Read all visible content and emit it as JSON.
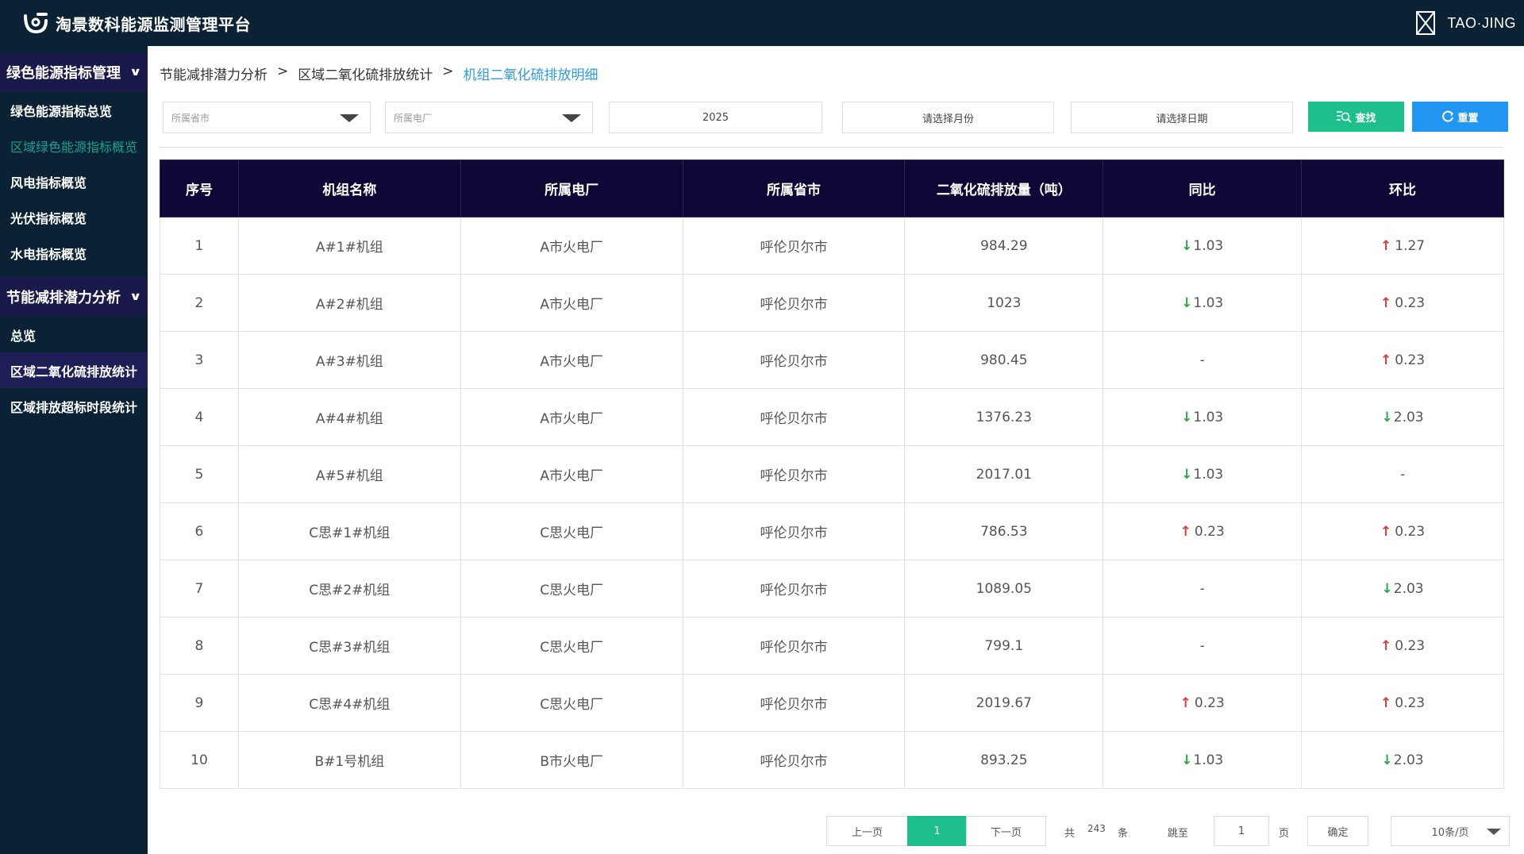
{
  "app": {
    "title": "淘景数科能源监测管理平台",
    "brand_right": "TAO·JING"
  },
  "sidebar": {
    "groups": [
      {
        "label": "绿色能源指标管理",
        "items": [
          "绿色能源指标总览",
          "区域绿色能源指标概览",
          "风电指标概览",
          "光伏指标概览",
          "水电指标概览"
        ]
      },
      {
        "label": "节能减排潜力分析",
        "items": [
          "总览",
          "区域二氧化硫排放统计",
          "区域排放超标时段统计"
        ]
      }
    ]
  },
  "breadcrumb": {
    "level1": "节能减排潜力分析",
    "level2": "区域二氧化硫排放统计",
    "current": "机组二氧化硫排放明细",
    "sep": ">"
  },
  "filters": {
    "province_placeholder": "所属省市",
    "plant_placeholder": "所属电厂",
    "year_value": "2025",
    "month_placeholder": "请选择月份",
    "date_placeholder": "请选择日期",
    "search_label": "查找",
    "reset_label": "重置"
  },
  "table": {
    "headers": [
      "序号",
      "机组名称",
      "所属电厂",
      "所属省市",
      "二氧化硫排放量（吨）",
      "同比",
      "环比"
    ],
    "rows": [
      {
        "no": "1",
        "unit": "A#1#机组",
        "plant": "A市火电厂",
        "city": "呼伦贝尔市",
        "so2": "984.29",
        "yoy_dir": "↓",
        "yoy": "1.03",
        "mom_dir": "↑",
        "mom": "1.27"
      },
      {
        "no": "2",
        "unit": "A#2#机组",
        "plant": "A市火电厂",
        "city": "呼伦贝尔市",
        "so2": "1023",
        "yoy_dir": "↓",
        "yoy": "1.03",
        "mom_dir": "↑",
        "mom": "0.23"
      },
      {
        "no": "3",
        "unit": "A#3#机组",
        "plant": "A市火电厂",
        "city": "呼伦贝尔市",
        "so2": "980.45",
        "yoy_dir": "",
        "yoy": "-",
        "mom_dir": "↑",
        "mom": "0.23"
      },
      {
        "no": "4",
        "unit": "A#4#机组",
        "plant": "A市火电厂",
        "city": "呼伦贝尔市",
        "so2": "1376.23",
        "yoy_dir": "↓",
        "yoy": "1.03",
        "mom_dir": "↓",
        "mom": "2.03"
      },
      {
        "no": "5",
        "unit": "A#5#机组",
        "plant": "A市火电厂",
        "city": "呼伦贝尔市",
        "so2": "2017.01",
        "yoy_dir": "↓",
        "yoy": "1.03",
        "mom_dir": "",
        "mom": "-"
      },
      {
        "no": "6",
        "unit": "C思#1#机组",
        "plant": "C思火电厂",
        "city": "呼伦贝尔市",
        "so2": "786.53",
        "yoy_dir": "↑",
        "yoy": "0.23",
        "mom_dir": "↑",
        "mom": "0.23"
      },
      {
        "no": "7",
        "unit": "C思#2#机组",
        "plant": "C思火电厂",
        "city": "呼伦贝尔市",
        "so2": "1089.05",
        "yoy_dir": "",
        "yoy": "-",
        "mom_dir": "↓",
        "mom": "2.03"
      },
      {
        "no": "8",
        "unit": "C思#3#机组",
        "plant": "C思火电厂",
        "city": "呼伦贝尔市",
        "so2": "799.1",
        "yoy_dir": "",
        "yoy": "-",
        "mom_dir": "↑",
        "mom": "0.23"
      },
      {
        "no": "9",
        "unit": "C思#4#机组",
        "plant": "C思火电厂",
        "city": "呼伦贝尔市",
        "so2": "2019.67",
        "yoy_dir": "↑",
        "yoy": "0.23",
        "mom_dir": "↑",
        "mom": "0.23"
      },
      {
        "no": "10",
        "unit": "B#1号机组",
        "plant": "B市火电厂",
        "city": "呼伦贝尔市",
        "so2": "893.25",
        "yoy_dir": "↓",
        "yoy": "1.03",
        "mom_dir": "↓",
        "mom": "2.03"
      }
    ]
  },
  "pagination": {
    "prev_label": "上一页",
    "current_page": "1",
    "next_label": "下一页",
    "total_prefix": "共",
    "total": "243",
    "total_suffix": "条",
    "jump_label": "跳至",
    "jump_value": "1",
    "page_suffix": "页",
    "confirm_label": "确定",
    "page_size": "10条/页"
  },
  "colors": {
    "topbar": "#0a2233",
    "header_bg": "#0e0836",
    "accent_green": "#1dc08c",
    "accent_blue": "#2196f3",
    "up": "#e33a2c",
    "down": "#2ca24a"
  }
}
